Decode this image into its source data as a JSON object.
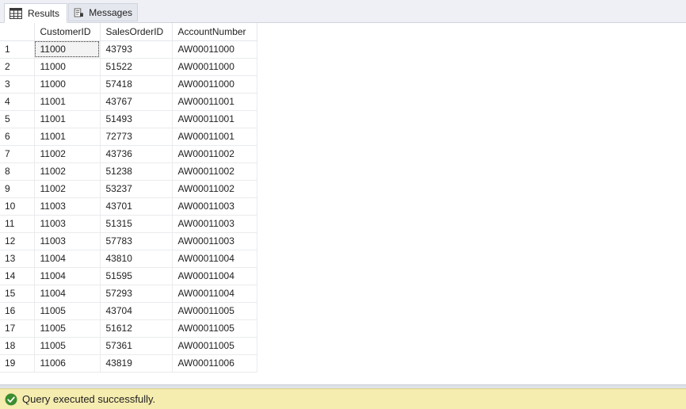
{
  "tabs": [
    {
      "label": "Results",
      "icon": "grid-icon",
      "active": true
    },
    {
      "label": "Messages",
      "icon": "messages-icon",
      "active": false
    }
  ],
  "grid": {
    "columns": [
      "CustomerID",
      "SalesOrderID",
      "AccountNumber"
    ],
    "rows": [
      {
        "n": "1",
        "CustomerID": "11000",
        "SalesOrderID": "43793",
        "AccountNumber": "AW00011000"
      },
      {
        "n": "2",
        "CustomerID": "11000",
        "SalesOrderID": "51522",
        "AccountNumber": "AW00011000"
      },
      {
        "n": "3",
        "CustomerID": "11000",
        "SalesOrderID": "57418",
        "AccountNumber": "AW00011000"
      },
      {
        "n": "4",
        "CustomerID": "11001",
        "SalesOrderID": "43767",
        "AccountNumber": "AW00011001"
      },
      {
        "n": "5",
        "CustomerID": "11001",
        "SalesOrderID": "51493",
        "AccountNumber": "AW00011001"
      },
      {
        "n": "6",
        "CustomerID": "11001",
        "SalesOrderID": "72773",
        "AccountNumber": "AW00011001"
      },
      {
        "n": "7",
        "CustomerID": "11002",
        "SalesOrderID": "43736",
        "AccountNumber": "AW00011002"
      },
      {
        "n": "8",
        "CustomerID": "11002",
        "SalesOrderID": "51238",
        "AccountNumber": "AW00011002"
      },
      {
        "n": "9",
        "CustomerID": "11002",
        "SalesOrderID": "53237",
        "AccountNumber": "AW00011002"
      },
      {
        "n": "10",
        "CustomerID": "11003",
        "SalesOrderID": "43701",
        "AccountNumber": "AW00011003"
      },
      {
        "n": "11",
        "CustomerID": "11003",
        "SalesOrderID": "51315",
        "AccountNumber": "AW00011003"
      },
      {
        "n": "12",
        "CustomerID": "11003",
        "SalesOrderID": "57783",
        "AccountNumber": "AW00011003"
      },
      {
        "n": "13",
        "CustomerID": "11004",
        "SalesOrderID": "43810",
        "AccountNumber": "AW00011004"
      },
      {
        "n": "14",
        "CustomerID": "11004",
        "SalesOrderID": "51595",
        "AccountNumber": "AW00011004"
      },
      {
        "n": "15",
        "CustomerID": "11004",
        "SalesOrderID": "57293",
        "AccountNumber": "AW00011004"
      },
      {
        "n": "16",
        "CustomerID": "11005",
        "SalesOrderID": "43704",
        "AccountNumber": "AW00011005"
      },
      {
        "n": "17",
        "CustomerID": "11005",
        "SalesOrderID": "51612",
        "AccountNumber": "AW00011005"
      },
      {
        "n": "18",
        "CustomerID": "11005",
        "SalesOrderID": "57361",
        "AccountNumber": "AW00011005"
      },
      {
        "n": "19",
        "CustomerID": "11006",
        "SalesOrderID": "43819",
        "AccountNumber": "AW00011006"
      }
    ]
  },
  "status": {
    "text": "Query executed successfully.",
    "icon": "check-circle-icon",
    "icon_color": "#3c8d2f",
    "background": "#f5ecb0"
  }
}
